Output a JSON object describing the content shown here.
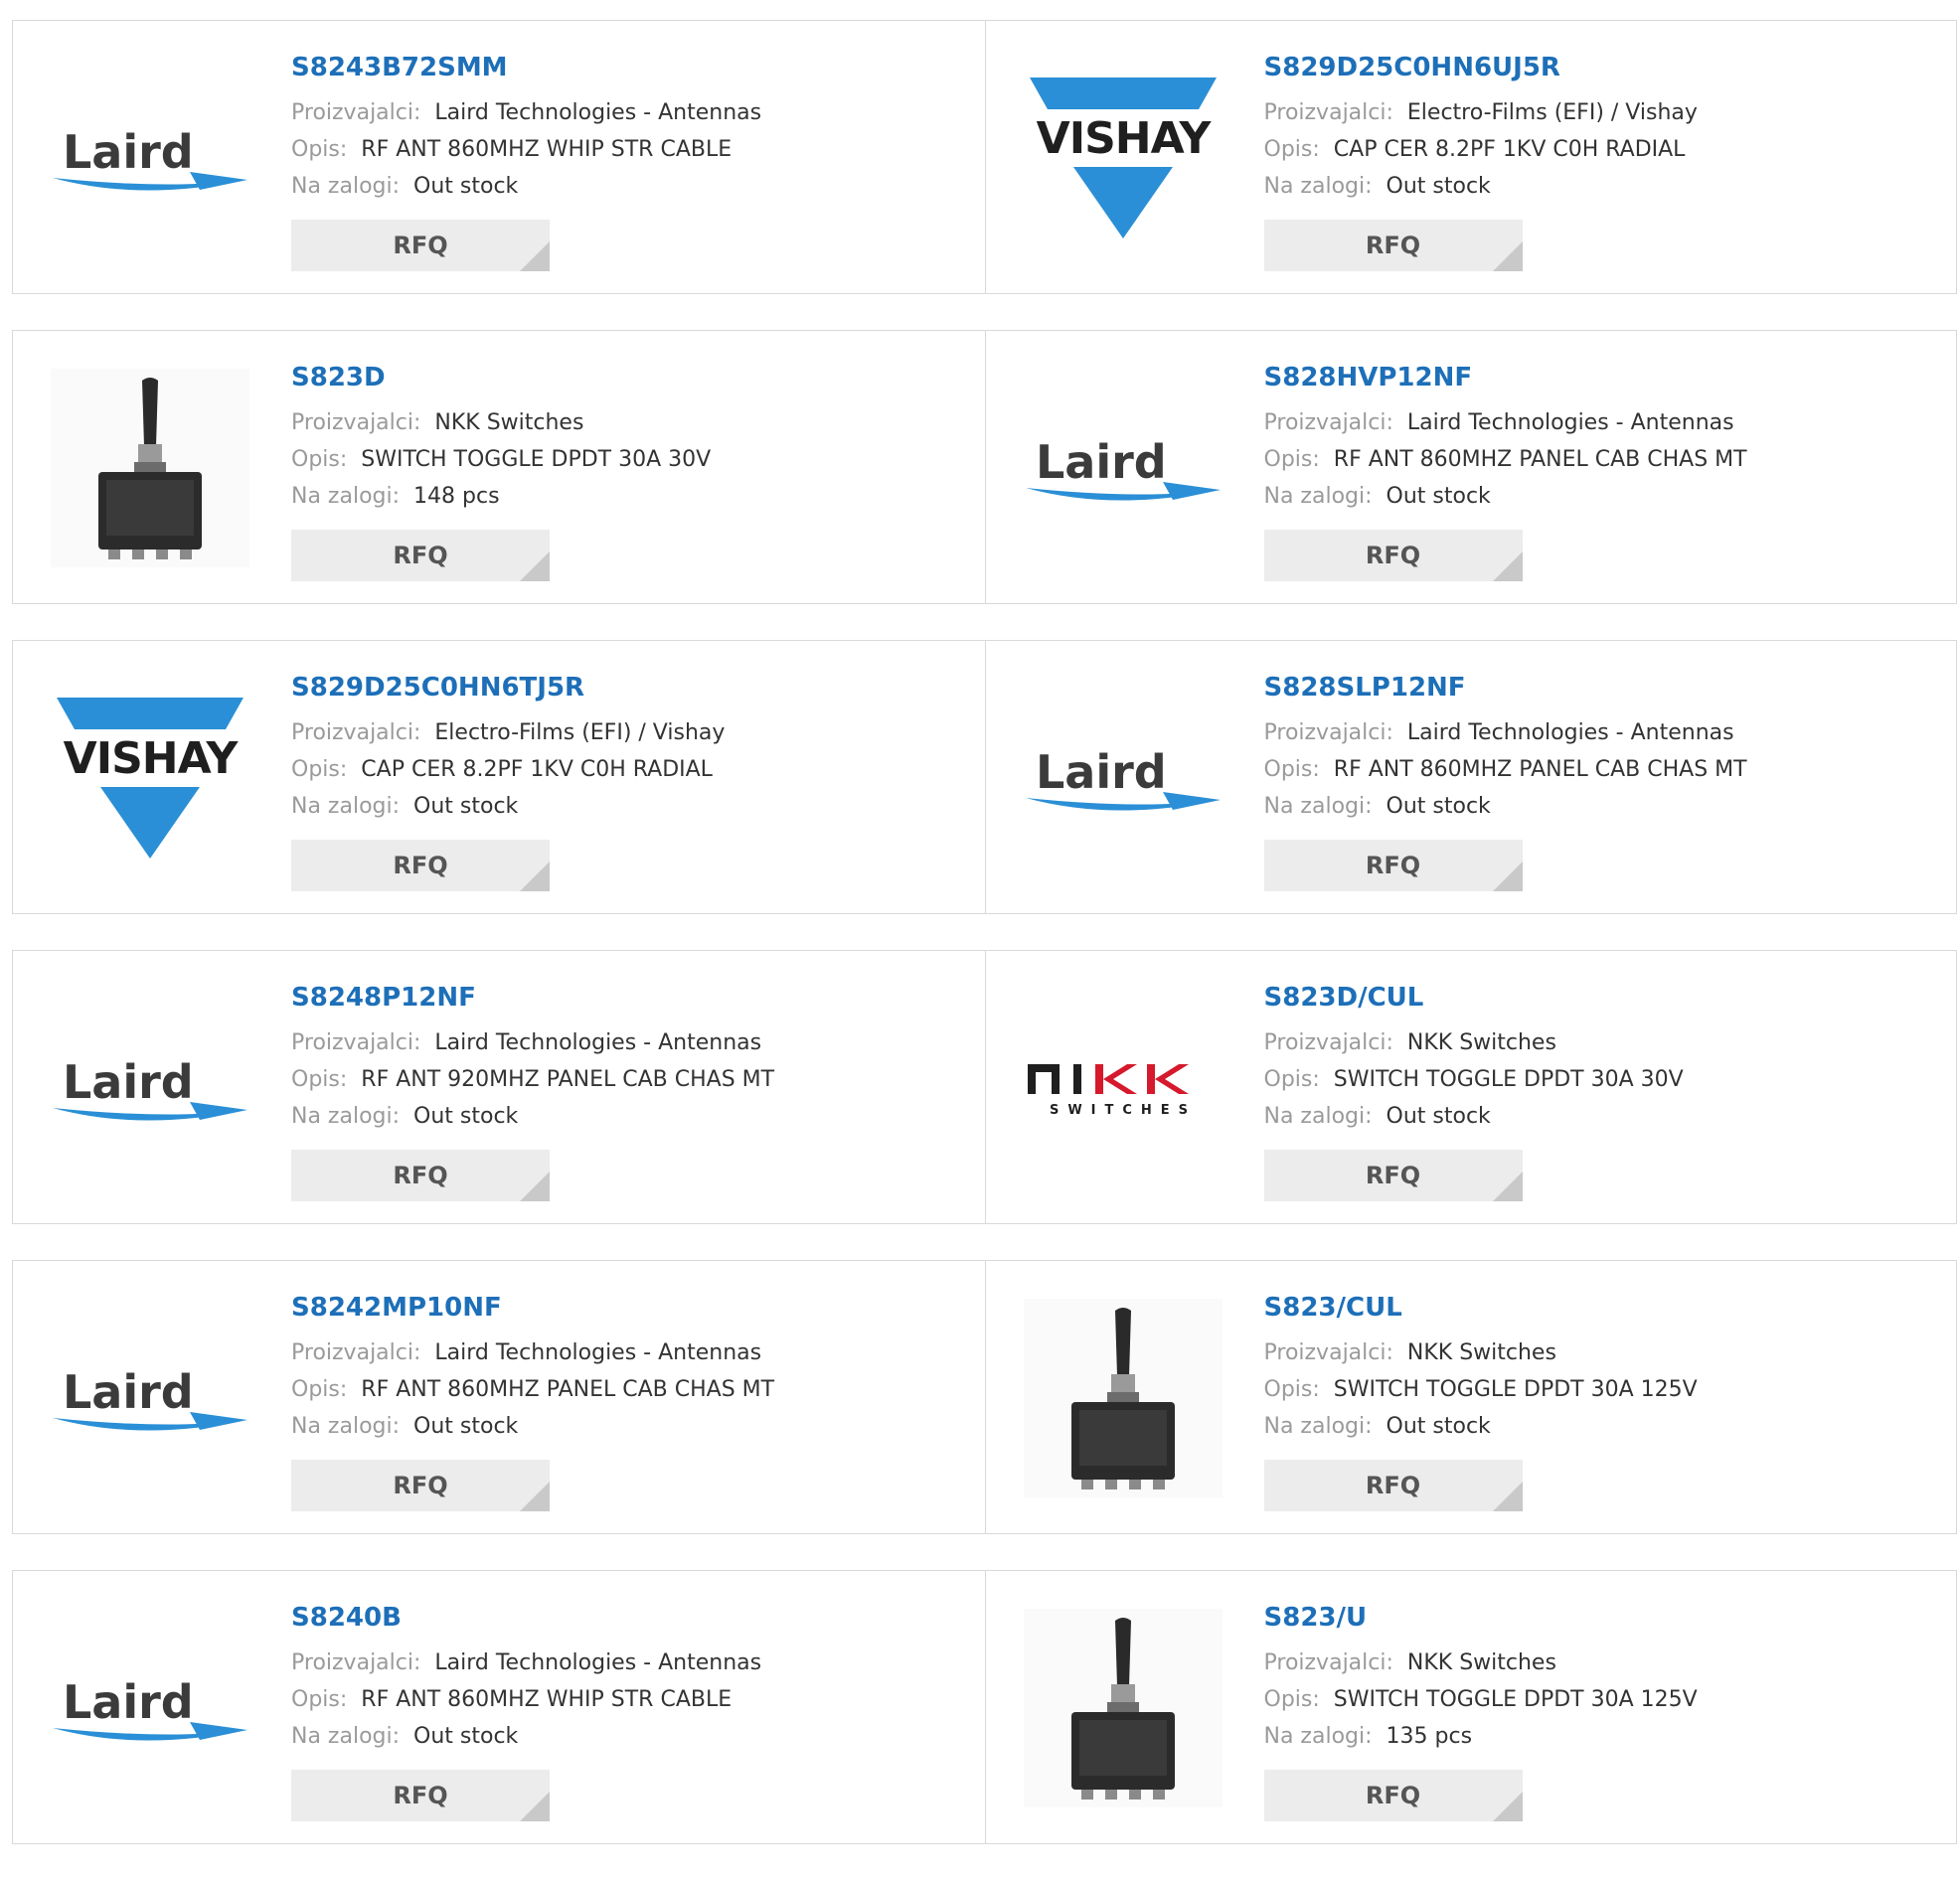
{
  "labels": {
    "manufacturer": "Proizvajalci:",
    "description": "Opis:",
    "stock": "Na zalogi:",
    "rfq": "RFQ"
  },
  "brand_colors": {
    "link": "#1d6fb8",
    "laird_swoosh": "#2a8fd6",
    "vishay_blue": "#2a8fd6",
    "nkk_red": "#d6192c"
  },
  "products": [
    {
      "part": "S8243B72SMM",
      "manufacturer": "Laird Technologies - Antennas",
      "description": "RF ANT 860MHZ WHIP STR CABLE",
      "stock": "Out stock",
      "logo": "laird-logo"
    },
    {
      "part": "S829D25C0HN6UJ5R",
      "manufacturer": "Electro-Films (EFI) / Vishay",
      "description": "CAP CER 8.2PF 1KV C0H RADIAL",
      "stock": "Out stock",
      "logo": "vishay-logo"
    },
    {
      "part": "S823D",
      "manufacturer": "NKK Switches",
      "description": "SWITCH TOGGLE DPDT 30A 30V",
      "stock": "148 pcs",
      "logo": "toggle-switch-photo"
    },
    {
      "part": "S828HVP12NF",
      "manufacturer": "Laird Technologies - Antennas",
      "description": "RF ANT 860MHZ PANEL CAB CHAS MT",
      "stock": "Out stock",
      "logo": "laird-logo"
    },
    {
      "part": "S829D25C0HN6TJ5R",
      "manufacturer": "Electro-Films (EFI) / Vishay",
      "description": "CAP CER 8.2PF 1KV C0H RADIAL",
      "stock": "Out stock",
      "logo": "vishay-logo"
    },
    {
      "part": "S828SLP12NF",
      "manufacturer": "Laird Technologies - Antennas",
      "description": "RF ANT 860MHZ PANEL CAB CHAS MT",
      "stock": "Out stock",
      "logo": "laird-logo"
    },
    {
      "part": "S8248P12NF",
      "manufacturer": "Laird Technologies - Antennas",
      "description": "RF ANT 920MHZ PANEL CAB CHAS MT",
      "stock": "Out stock",
      "logo": "laird-logo"
    },
    {
      "part": "S823D/CUL",
      "manufacturer": "NKK Switches",
      "description": "SWITCH TOGGLE DPDT 30A 30V",
      "stock": "Out stock",
      "logo": "nkk-logo"
    },
    {
      "part": "S8242MP10NF",
      "manufacturer": "Laird Technologies - Antennas",
      "description": "RF ANT 860MHZ PANEL CAB CHAS MT",
      "stock": "Out stock",
      "logo": "laird-logo"
    },
    {
      "part": "S823/CUL",
      "manufacturer": "NKK Switches",
      "description": "SWITCH TOGGLE DPDT 30A 125V",
      "stock": "Out stock",
      "logo": "toggle-switch-photo"
    },
    {
      "part": "S8240B",
      "manufacturer": "Laird Technologies - Antennas",
      "description": "RF ANT 860MHZ WHIP STR CABLE",
      "stock": "Out stock",
      "logo": "laird-logo"
    },
    {
      "part": "S823/U",
      "manufacturer": "NKK Switches",
      "description": "SWITCH TOGGLE DPDT 30A 125V",
      "stock": "135 pcs",
      "logo": "toggle-switch-photo"
    }
  ]
}
